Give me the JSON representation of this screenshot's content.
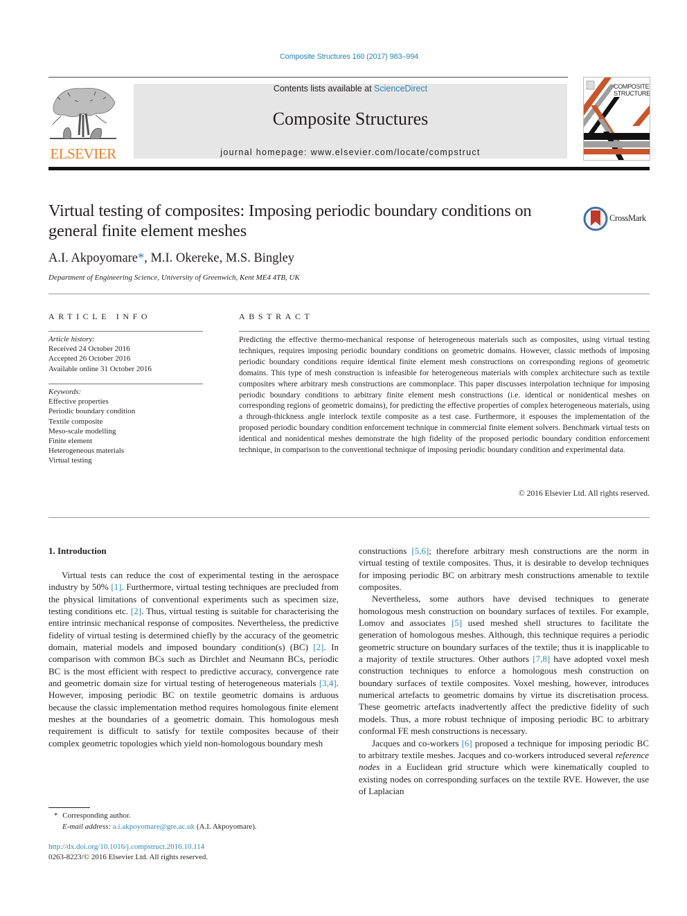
{
  "header": {
    "citation": "Composite Structures 160 (2017) 983–994",
    "contents_prefix": "Contents lists available at ",
    "contents_link": "ScienceDirect",
    "journal_title": "Composite Structures",
    "homepage_prefix": "journal homepage: ",
    "homepage_url": "www.elsevier.com/locate/compstruct",
    "publisher_logo_text": "ELSEVIER",
    "cover_text_line1": "COMPOSITE",
    "cover_text_line2": "STRUCTURES",
    "colors": {
      "link": "#2a87b4",
      "elsevier_orange": "#f07d24",
      "cover_orange": "#c8552b"
    }
  },
  "article": {
    "title_line1": "Virtual testing of composites: Imposing periodic boundary conditions on",
    "title_line2": "general finite element meshes",
    "crossmark_label": "CrossMark",
    "authors": [
      {
        "name": "A.I. Akpoyomare",
        "corresponding_mark": "*"
      },
      {
        "name": "M.I. Okereke"
      },
      {
        "name": "M.S. Bingley"
      }
    ],
    "author_separator": ", ",
    "affiliation": "Department of Engineering Science, University of Greenwich, Kent ME4 4TB, UK"
  },
  "article_info": {
    "heading": "ARTICLE INFO",
    "history_label": "Article history:",
    "history": [
      "Received 24 October 2016",
      "Accepted 26 October 2016",
      "Available online 31 October 2016"
    ],
    "keywords_label": "Keywords:",
    "keywords": [
      "Effective properties",
      "Periodic boundary condition",
      "Textile composite",
      "Meso-scale modelling",
      "Finite element",
      "Heterogeneous materials",
      "Virtual testing"
    ]
  },
  "abstract": {
    "heading": "ABSTRACT",
    "text": "Predicting the effective thermo-mechanical response of heterogeneous materials such as composites, using virtual testing techniques, requires imposing periodic boundary conditions on geometric domains. However, classic methods of imposing periodic boundary conditions require identical finite element mesh constructions on corresponding regions of geometric domains. This type of mesh construction is infeasible for heterogeneous materials with complex architecture such as textile composites where arbi­trary mesh constructions are commonplace. This paper discusses interpolation technique for imposing periodic boundary conditions to arbitrary finite element mesh constructions (i.e. identical or non­identical meshes on corresponding regions of geometric domains), for predicting the effective properties of complex heterogeneous materials, using a through-thickness angle interlock textile composite as a test case. Furthermore, it espouses the implementation of the proposed periodic boundary condition enforce­ment technique in commercial finite element solvers. Benchmark virtual tests on identical and non­identical meshes demonstrate the high fidelity of the proposed periodic boundary condition enforcement technique, in comparison to the conventional technique of imposing periodic boundary condition and experimental data.",
    "copyright": "© 2016 Elsevier Ltd. All rights reserved."
  },
  "body": {
    "section_heading": "1. Introduction",
    "left_column": {
      "p1": [
        {
          "t": "Virtual tests can reduce the cost of experimental testing in the aerospace industry by 50% "
        },
        {
          "ref": "[1]"
        },
        {
          "t": ". Furthermore, virtual testing tech­niques are precluded from the physical limitations of conventional experiments such as specimen size, testing conditions etc. "
        },
        {
          "ref": "[2]"
        },
        {
          "t": ". Thus, virtual testing is suitable for characterising the entire intrin­sic mechanical response of composites. Nevertheless, the predic­tive fidelity of virtual testing is determined chiefly by the accuracy of the geometric domain, material models and imposed boundary condition(s) (BC) "
        },
        {
          "ref": "[2]"
        },
        {
          "t": ". In comparison with common BCs such as Dirchlet and Neumann BCs, periodic BC is the most efficient with respect to predictive accuracy, convergence rate and geomet­ric domain size for virtual testing of heterogeneous materials "
        },
        {
          "ref": "[3,4]"
        },
        {
          "t": ". However, imposing periodic BC on textile geometric domains is arduous because the classic implementation method requires homologous finite element meshes at the boundaries of a geometric domain. This homologous mesh requirement is difficult to satisfy for textile composites because of their complex geometric topologies which yield non-homologous boundary mesh"
        }
      ]
    },
    "right_column": {
      "p1": [
        {
          "t": "constructions "
        },
        {
          "ref": "[5,6]"
        },
        {
          "t": "; therefore arbitrary mesh constructions are the norm in virtual testing of textile composites. Thus, it is desirable to develop techniques for imposing periodic BC on arbitrary mesh constructions amenable to textile composites."
        }
      ],
      "p2": [
        {
          "t": "Nevertheless, some authors have devised techniques to gener­ate homologous mesh construction on boundary surfaces of tex­tiles. For example, Lomov and associates "
        },
        {
          "ref": "[5]"
        },
        {
          "t": " used meshed shell structures to facilitate the generation of homologous meshes. Although, this technique requires a periodic geometric structure on boundary surfaces of the textile; thus it is inapplicable to a majority of textile structures. Other authors "
        },
        {
          "ref": "[7,8]"
        },
        {
          "t": " have adopted voxel mesh construction techniques to enforce a homologous mesh construction on boundary surfaces of textile composites. Voxel meshing, however, introduces numerical artefacts to geometric domains by virtue its discretisation process. These geometric arte­facts inadvertently affect the predictive fidelity of such models. Thus, a more robust technique of imposing periodic BC to arbitrary conformal FE mesh constructions is necessary."
        }
      ],
      "p3": [
        {
          "t": "Jacques and co-workers "
        },
        {
          "ref": "[6]"
        },
        {
          "t": " proposed a technique for imposing periodic BC to arbitrary textile meshes. Jacques and co-workers introduced several "
        },
        {
          "i": "reference nodes"
        },
        {
          "t": " in a Euclidean grid structure which were kinematically coupled to existing nodes on corre­sponding surfaces on the textile RVE. However, the use of Laplacian"
        }
      ]
    }
  },
  "footnotes": {
    "corresponding_mark": "*",
    "corresponding_text": "Corresponding author.",
    "email_label": "E-mail address:",
    "email": "a.i.akpoyomare@gre.ac.uk",
    "email_owner": "(A.I. Akpoyomare).",
    "doi": "http://dx.doi.org/10.1016/j.compstruct.2016.10.114",
    "issn_line": "0263-8223/© 2016 Elsevier Ltd. All rights reserved."
  }
}
